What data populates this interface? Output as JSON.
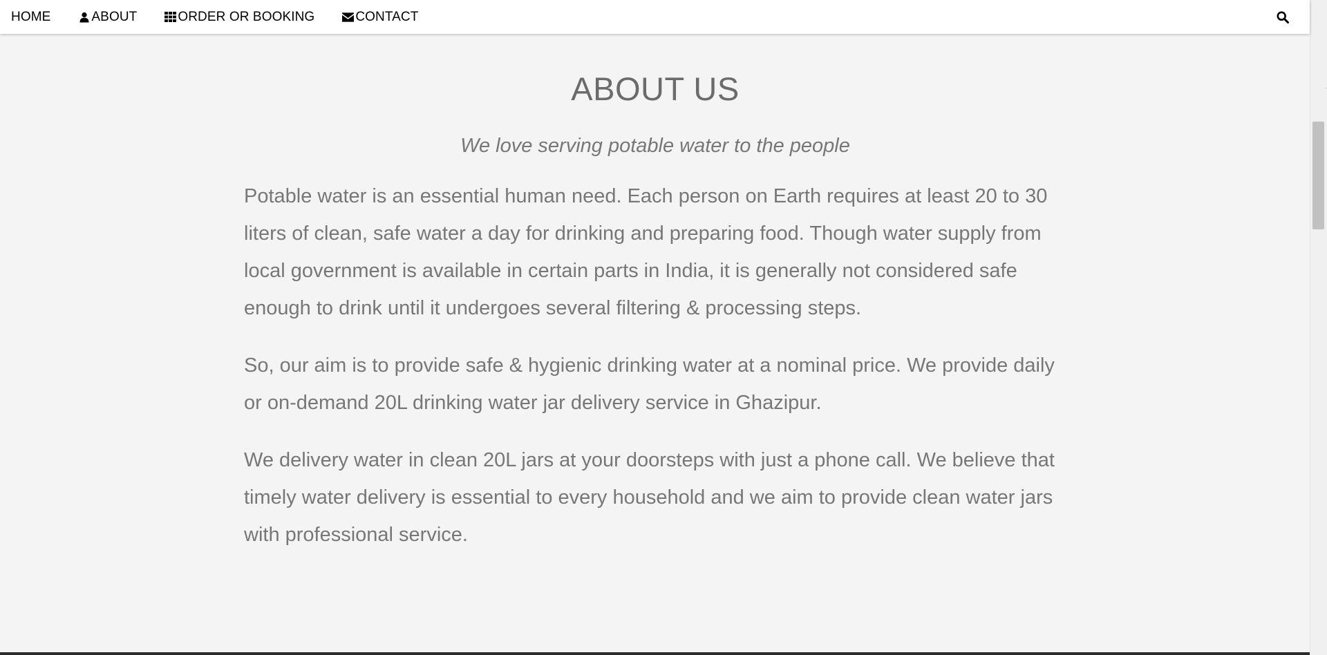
{
  "nav": {
    "items": [
      {
        "label": "HOME",
        "icon": ""
      },
      {
        "label": "ABOUT",
        "icon": "user-icon"
      },
      {
        "label": "ORDER OR BOOKING",
        "icon": "grid-icon"
      },
      {
        "label": "CONTACT",
        "icon": "envelope-icon"
      }
    ],
    "search_icon": "search-icon"
  },
  "about": {
    "title": "ABOUT US",
    "tagline": "We love serving potable water to the people",
    "paragraphs": [
      "Potable water is an essential human need. Each person on Earth requires at least 20 to 30 liters of clean, safe water a day for drinking and preparing food. Though water supply from local government is available in certain parts in India, it is generally not considered safe enough to drink until it undergoes several filtering & processing steps.",
      "So, our aim is to provide safe & hygienic drinking water at a nominal price. We provide daily or on-demand 20L drinking water jar delivery service in Ghazipur.",
      "We delivery water in clean 20L jars at your doorsteps with just a phone call. We believe that timely water delivery is essential to every household and we aim to provide clean water jars with professional service."
    ]
  },
  "colors": {
    "nav_text": "#000000",
    "heading": "#6b6b6b",
    "body_text": "#777777",
    "background": "#f4f4f4"
  }
}
